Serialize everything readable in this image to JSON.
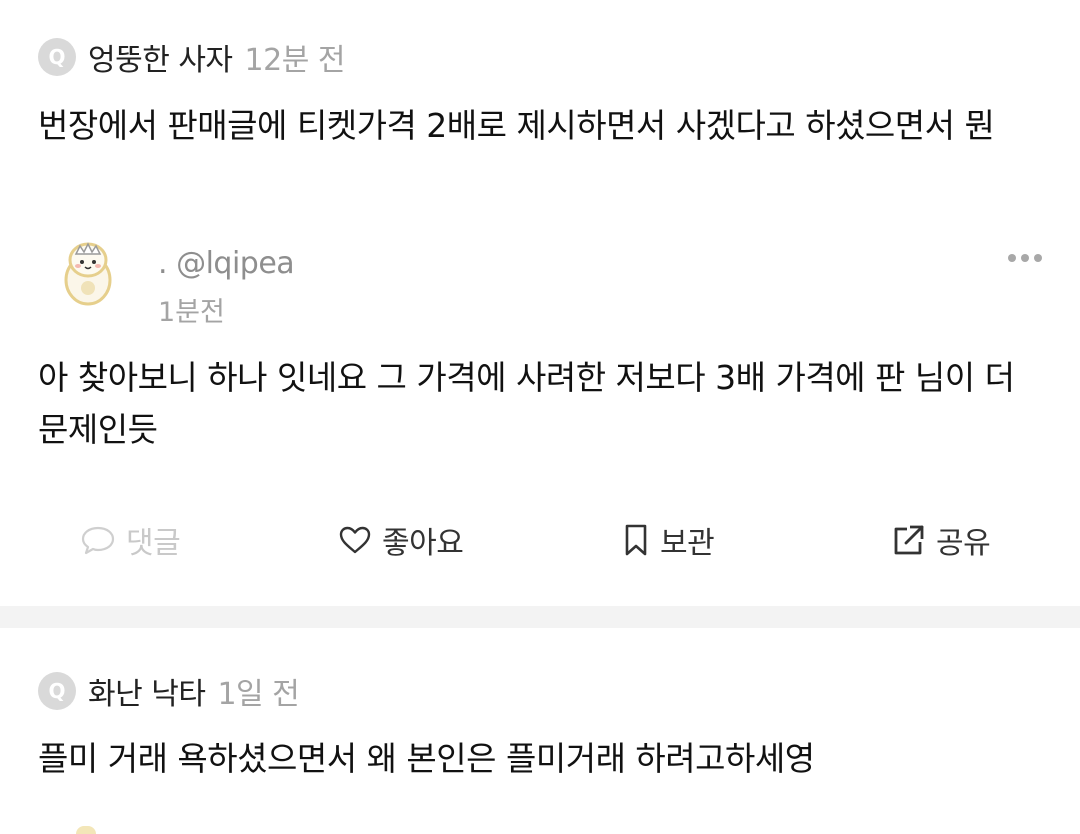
{
  "posts": [
    {
      "badge": "Q",
      "author": "엉뚱한 사자",
      "time": "12분 전",
      "question": "번장에서 판매글에 티켓가격 2배로 제시하면서 사겠다고 하셨으면서 뭔",
      "answer": {
        "handle": ". @lqipea",
        "time": "1분전",
        "body": "아 찾아보니 하나 잇네요 그 가격에 사려한 저보다 3배 가격에 판 님이 더 문제인듯"
      },
      "actions": {
        "comment": "댓글",
        "like": "좋아요",
        "save": "보관",
        "share": "공유"
      }
    },
    {
      "badge": "Q",
      "author": "화난 낙타",
      "time": "1일 전",
      "question": "플미 거래 욕하셨으면서 왜 본인은 플미거래 하려고하세영"
    }
  ],
  "icons": {
    "question_badge": "q-badge",
    "more": "more-dots-icon",
    "comment": "speech-bubble-icon",
    "like": "heart-icon",
    "save": "bookmark-icon",
    "share": "share-arrow-icon"
  },
  "colors": {
    "badge_bg": "#d9d9d9",
    "muted_text": "#a4a4a4",
    "disabled_action": "#c9c9c9",
    "section_divider": "#f3f3f3"
  }
}
